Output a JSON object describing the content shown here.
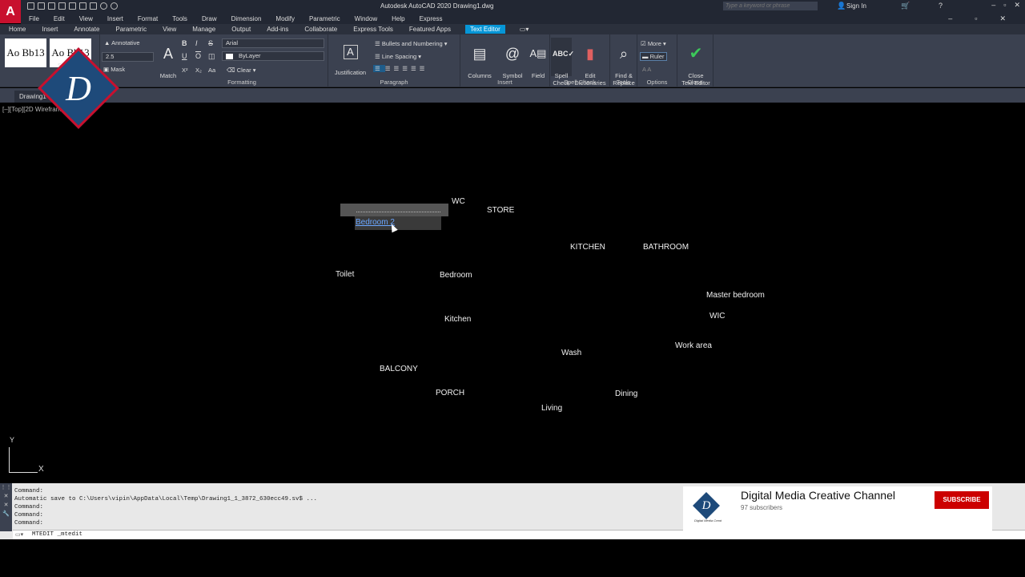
{
  "title_bar": {
    "app_logo": "A",
    "window_title": "Autodesk AutoCAD 2020   Drawing1.dwg",
    "search_placeholder": "Type a keyword or phrase",
    "sign_in": "Sign In",
    "controls": [
      "–",
      "▫",
      "✕"
    ]
  },
  "menu_bar": {
    "items": [
      "File",
      "Edit",
      "View",
      "Insert",
      "Format",
      "Tools",
      "Draw",
      "Dimension",
      "Modify",
      "Parametric",
      "Window",
      "Help",
      "Express"
    ],
    "mdi_controls": [
      "–",
      "▫",
      "✕"
    ]
  },
  "ribbon_tabs": [
    "Home",
    "Insert",
    "Annotate",
    "Parametric",
    "View",
    "Manage",
    "Output",
    "Add-ins",
    "Collaborate",
    "Express Tools",
    "Featured Apps",
    "Text Editor"
  ],
  "active_tab": "Text Editor",
  "ribbon": {
    "style": {
      "samples": [
        "Ao Bb13",
        "Ao Bb13"
      ],
      "sample_labels": [
        "Annotative",
        "Sta"
      ],
      "annotative": "Annotative",
      "text_height": "2.5",
      "mask": "Mask"
    },
    "formatting": {
      "title": "Formatting",
      "match": "Match",
      "bold": "B",
      "italic": "I",
      "strike": "S",
      "underline": "U",
      "overline": "O",
      "font": "Arial",
      "color": "ByLayer",
      "clear": "Clear",
      "superscript": "X²",
      "subscript": "X₂",
      "case": "Aa"
    },
    "paragraph": {
      "title": "Paragraph",
      "justification": "Justification",
      "bullets": "Bullets and Numbering",
      "line_spacing": "Line Spacing"
    },
    "insert": {
      "title": "Insert",
      "columns": "Columns",
      "symbol": "Symbol",
      "field": "Field"
    },
    "spell_check": {
      "title": "Spell Check",
      "spell": "Spell\nCheck",
      "dictionaries": "Edit\nDictionaries"
    },
    "tools": {
      "title": "Tools",
      "find": "Find &\nReplace"
    },
    "options": {
      "title": "Options",
      "more": "More",
      "ruler": "Ruler"
    },
    "close": {
      "title": "Close",
      "close_editor": "Close\nText Editor"
    }
  },
  "file_tab": "Drawing1*",
  "viewport_label": "[–][Top][2D Wireframe]",
  "canvas_labels": [
    {
      "id": "wc",
      "text": "WC"
    },
    {
      "id": "store",
      "text": "STORE"
    },
    {
      "id": "kitchen-upper",
      "text": "KITCHEN"
    },
    {
      "id": "bathroom",
      "text": "BATHROOM"
    },
    {
      "id": "toilet",
      "text": "Toilet"
    },
    {
      "id": "bedroom",
      "text": "Bedroom"
    },
    {
      "id": "master-bedroom",
      "text": "Master bedroom"
    },
    {
      "id": "wic",
      "text": "WIC"
    },
    {
      "id": "kitchen",
      "text": "Kitchen"
    },
    {
      "id": "work-area",
      "text": "Work area"
    },
    {
      "id": "wash",
      "text": "Wash"
    },
    {
      "id": "balcony",
      "text": "BALCONY"
    },
    {
      "id": "porch",
      "text": "PORCH"
    },
    {
      "id": "dining",
      "text": "Dining"
    },
    {
      "id": "living",
      "text": "Living"
    }
  ],
  "mtext_editor": {
    "text": "Bedroom 2"
  },
  "ucs": {
    "x": "X",
    "y": "Y"
  },
  "command_line": {
    "history": "Command:\nAutomatic save to C:\\Users\\vipin\\AppData\\Local\\Temp\\Drawing1_1_3872_630ecc49.sv$ ...\nCommand:\nCommand:\nCommand:",
    "current": "MTEDIT _mtedit"
  },
  "youtube_card": {
    "channel": "Digital Media Creative Channel",
    "subscribers": "97 subscribers",
    "subscribe": "SUBSCRIBE",
    "avatar_letter": "D",
    "avatar_caption": "Digital Media Creat"
  },
  "watermark_letter": "D"
}
